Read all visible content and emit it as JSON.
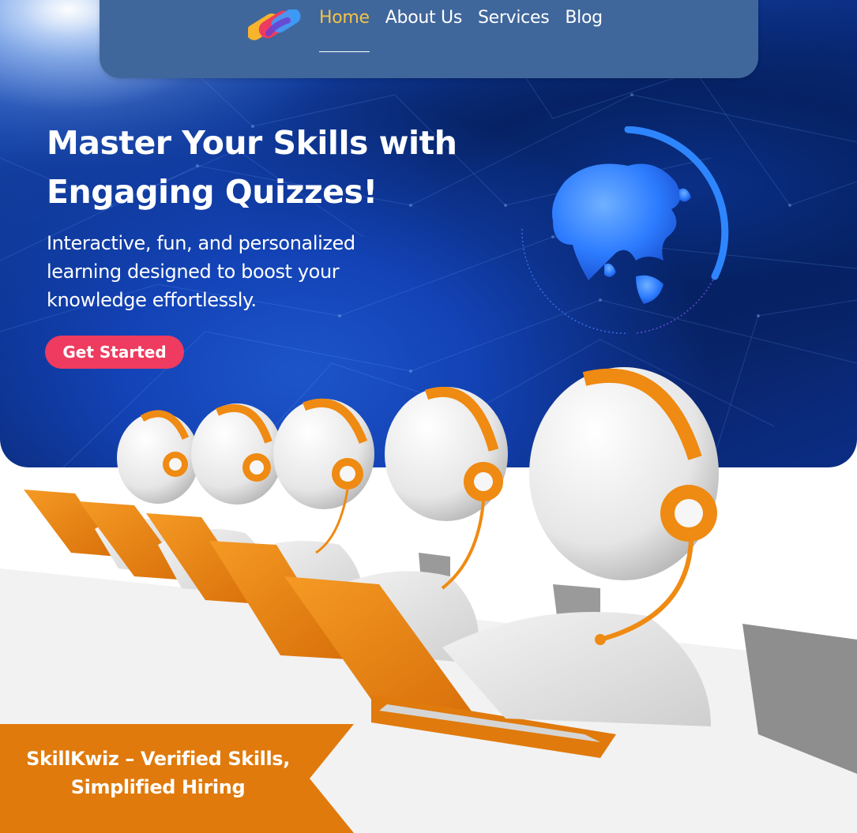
{
  "nav": {
    "items": [
      {
        "label": "Home",
        "active": true
      },
      {
        "label": "About Us",
        "active": false
      },
      {
        "label": "Services",
        "active": false
      },
      {
        "label": "Blog",
        "active": false
      }
    ]
  },
  "hero": {
    "title": "Master Your Skills with Engaging Quizzes!",
    "subtitle": "Interactive, fun, and personalized learning designed to boost your knowledge effortlessly.",
    "cta_label": "Get Started"
  },
  "ribbon": {
    "text": "SkillKwiz – Verified Skills, Simplified Hiring"
  },
  "colors": {
    "nav_bg": "#40679c",
    "nav_active": "#f4c346",
    "cta_bg": "#ee3b5f",
    "ribbon_bg": "#e07a0c",
    "accent_orange": "#ef8a12",
    "globe_blue": "#2d7cff"
  },
  "icons": {
    "logo": "brand-logo-icon",
    "globe": "globe-asia-icon"
  }
}
